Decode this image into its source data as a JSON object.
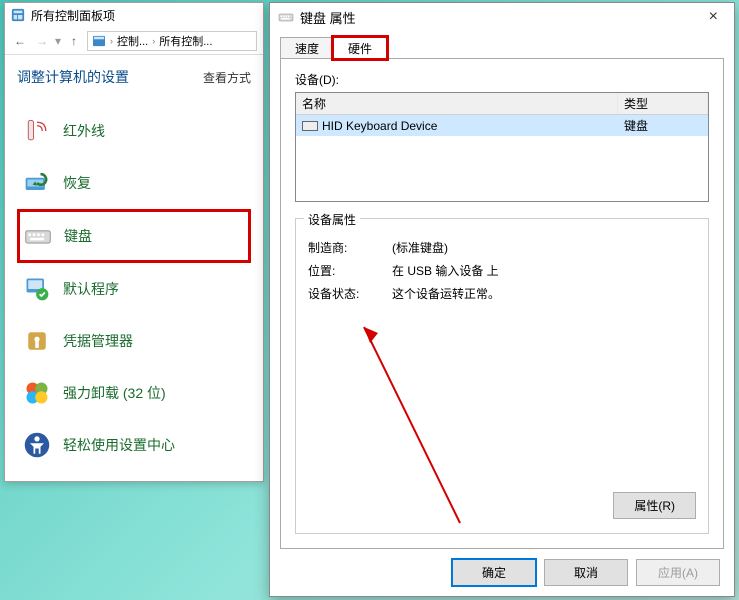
{
  "cp": {
    "window_title": "所有控制面板项",
    "breadcrumb": {
      "level1": "控制...",
      "level2": "所有控制..."
    },
    "header_title": "调整计算机的设置",
    "view_label": "查看方式",
    "items": [
      {
        "label": "红外线"
      },
      {
        "label": "恢复"
      },
      {
        "label": "键盘"
      },
      {
        "label": "默认程序"
      },
      {
        "label": "凭据管理器"
      },
      {
        "label": "强力卸载 (32 位)"
      },
      {
        "label": "轻松使用设置中心"
      }
    ]
  },
  "dialog": {
    "title": "键盘 属性",
    "tabs": {
      "speed": "速度",
      "hardware": "硬件"
    },
    "devices_label": "设备(D):",
    "table": {
      "col_name": "名称",
      "col_type": "类型",
      "row_name": "HID Keyboard Device",
      "row_type": "键盘"
    },
    "group_title": "设备属性",
    "manufacturer_label": "制造商:",
    "manufacturer_value": "(标准键盘)",
    "location_label": "位置:",
    "location_value": "在 USB 输入设备 上",
    "status_label": "设备状态:",
    "status_value": "这个设备运转正常。",
    "properties_btn": "属性(R)",
    "ok_btn": "确定",
    "cancel_btn": "取消",
    "apply_btn": "应用(A)"
  }
}
